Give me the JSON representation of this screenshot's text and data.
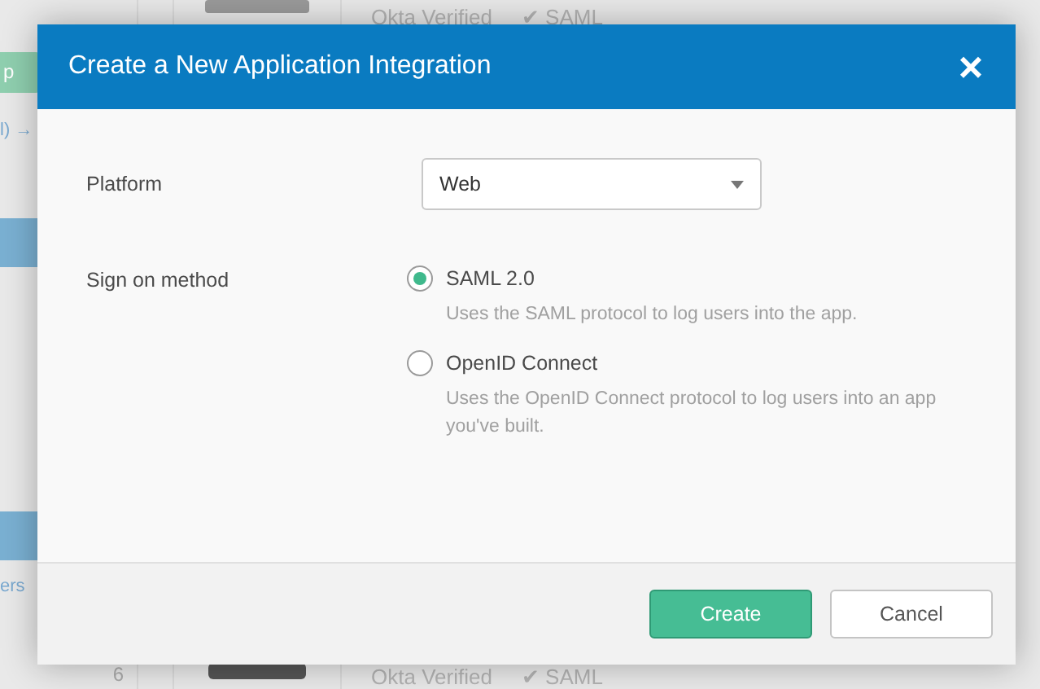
{
  "background": {
    "top_row": {
      "badge": "Okta Verified",
      "protocol": "✔ SAML"
    },
    "side_button": "p",
    "side_link": "l) →",
    "side_link_2": "ers",
    "bottom_row": {
      "index": "6",
      "badge": "Okta Verified",
      "protocol": "✔ SAML"
    }
  },
  "dialog": {
    "title": "Create a New Application Integration",
    "close": "×",
    "platform": {
      "label": "Platform",
      "value": "Web"
    },
    "sign_on": {
      "label": "Sign on method",
      "options": [
        {
          "label": "SAML 2.0",
          "description": "Uses the SAML protocol to log users into the app.",
          "selected": true
        },
        {
          "label": "OpenID Connect",
          "description": "Uses the OpenID Connect protocol to log users into an app you've built.",
          "selected": false
        }
      ]
    },
    "buttons": [
      {
        "label": "Create",
        "kind": "primary"
      },
      {
        "label": "Cancel",
        "kind": "secondary"
      }
    ]
  }
}
